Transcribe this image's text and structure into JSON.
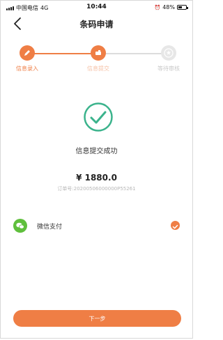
{
  "status_bar": {
    "carrier": "中国电信",
    "network": "4G",
    "time": "10:44",
    "battery": "48%"
  },
  "nav": {
    "title": "条码申请",
    "back_icon": "chevron-left-icon"
  },
  "steps": [
    {
      "label": "信息录入",
      "state": "active",
      "icon": "pencil-icon"
    },
    {
      "label": "信息提交",
      "state": "active",
      "icon": "card-icon"
    },
    {
      "label": "等待审核",
      "state": "inactive",
      "icon": "star-icon"
    }
  ],
  "result": {
    "icon": "check-circle-icon",
    "message": "信息提交成功",
    "amount": "¥ 1880.0",
    "order_number": "订单号:20200506000000P55261"
  },
  "payment": {
    "method": "微信支付",
    "icon": "wechat-icon",
    "selected": true
  },
  "next_button": {
    "label": "下一步"
  },
  "colors": {
    "accent": "#ef7e45",
    "success": "#3bb38c",
    "wechat": "#5fbf3c",
    "inactive": "#e7e7e7"
  }
}
